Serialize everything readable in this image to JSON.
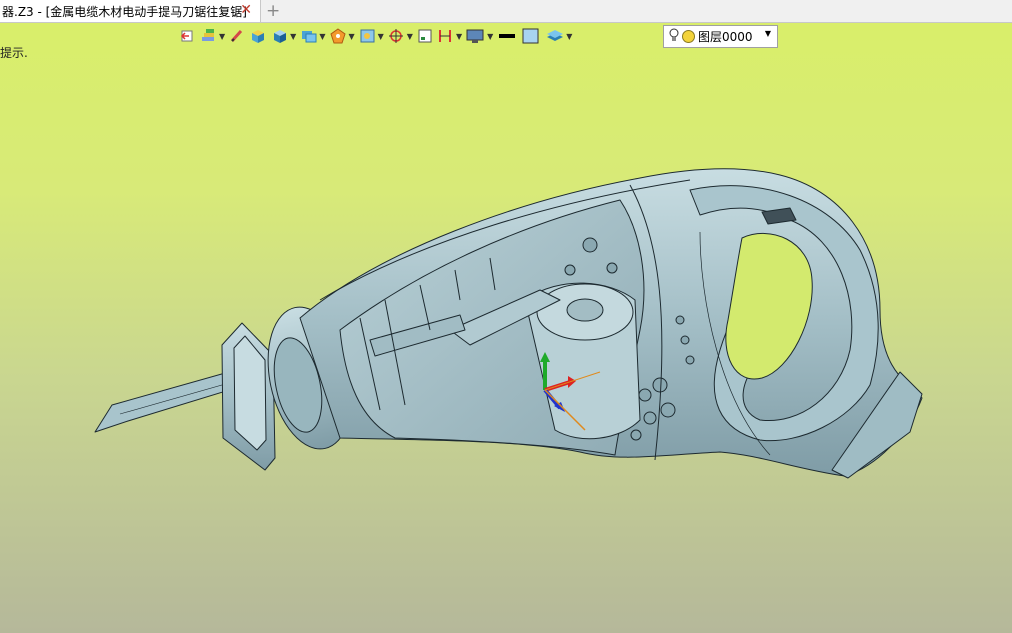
{
  "window": {
    "tab_title": "器.Z3 - [金属电缆木材电动手提马刀锯往复锯]",
    "close_glyph": "✕",
    "add_glyph": "+"
  },
  "hint_text": "提示.",
  "toolbar": {
    "items": [
      "exit-icon",
      "layers-stack-icon",
      "pen-icon",
      "shaded-cube-icon",
      "view-cube-icon",
      "display-mode-icon",
      "render-icon",
      "frame-icon",
      "snap-target-icon",
      "select-box-icon",
      "dimension-icon",
      "screen-icon",
      "line-color-swatch",
      "fill-color-swatch",
      "layer-stack-icon"
    ]
  },
  "layer": {
    "label": "图层0000"
  },
  "colors": {
    "bg_top": "#d9ef68",
    "bg_bottom": "#b5b89a",
    "model_fill": "#a8c4cc",
    "model_edge": "#1d2a30"
  }
}
